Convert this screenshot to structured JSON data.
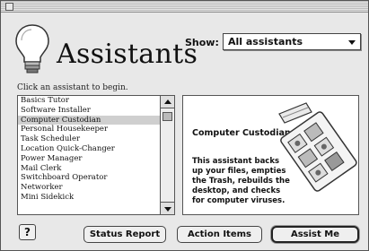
{
  "header": {
    "title": "Assistants",
    "show_label": "Show:",
    "show_value": "All assistants"
  },
  "hint": "Click an assistant to begin.",
  "assistants": [
    "Basics Tutor",
    "Software Installer",
    "Computer Custodian",
    "Personal Housekeeper",
    "Task Scheduler",
    "Location Quick-Changer",
    "Power Manager",
    "Mail Clerk",
    "Switchboard Operator",
    "Networker",
    "Mini Sidekick"
  ],
  "selected_index": 2,
  "detail": {
    "title": "Computer Custodian",
    "text": "This assistant backs up your files, empties the Trash, rebuilds the desktop, and checks for computer viruses."
  },
  "buttons": {
    "help": "?",
    "status_report": "Status Report",
    "action_items": "Action Items",
    "assist_me": "Assist Me"
  },
  "icons": {
    "close": "close-box-icon",
    "bulb": "lightbulb-icon",
    "art": "custodian-tools-icon"
  }
}
